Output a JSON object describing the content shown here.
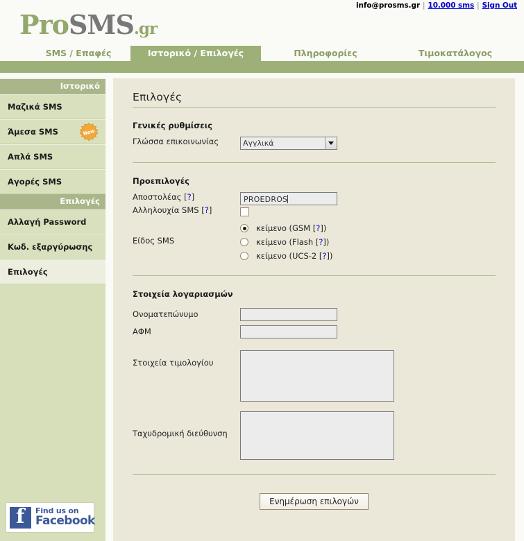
{
  "topbar": {
    "email": "info@prosms.gr",
    "separator": "|",
    "credits": "10.000 sms",
    "signout": "Sign Out"
  },
  "logo": {
    "part1": "Pro",
    "part2": "SMS",
    "part3": ".gr"
  },
  "nav": {
    "tabs": [
      {
        "label": "SMS / Επαφές",
        "active": false
      },
      {
        "label": "Ιστορικό / Επιλογές",
        "active": true
      },
      {
        "label": "Πληροφορίες",
        "active": false
      },
      {
        "label": "Τιμοκατάλογος",
        "active": false
      }
    ]
  },
  "sidebar": {
    "group1_title": "Ιστορικό",
    "group1_items": [
      {
        "label": "Μαζικά SMS",
        "badge": ""
      },
      {
        "label": "Άμεσα SMS",
        "badge": "New"
      },
      {
        "label": "Απλά SMS",
        "badge": ""
      },
      {
        "label": "Αγορές SMS",
        "badge": ""
      }
    ],
    "group2_title": "Επιλογές",
    "group2_items": [
      {
        "label": "Αλλαγή Password",
        "selected": false
      },
      {
        "label": "Κωδ. εξαργύρωσης",
        "selected": false
      },
      {
        "label": "Επιλογές",
        "selected": true
      }
    ],
    "facebook": {
      "line1": "Find us on",
      "line2": "Facebook",
      "icon": "facebook-f-icon"
    }
  },
  "main": {
    "page_title": "Επιλογές",
    "section_general": "Γενικές ρυθμίσεις",
    "language_label": "Γλώσσα επικοινωνίας",
    "language_value": "Αγγλικά",
    "language_options": [
      "Αγγλικά"
    ],
    "section_defaults": "Προεπιλογές",
    "sender_label": "Αποστολέας",
    "sender_help": "?",
    "sender_value": "PROEDROS",
    "concat_label": "Αλληλουχία SMS",
    "concat_help": "?",
    "concat_checked": false,
    "smstype_label": "Είδος SMS",
    "smstype_options": [
      {
        "label": "κείμενο (GSM [",
        "help": "?",
        "tail": "])",
        "checked": true
      },
      {
        "label": "κείμενο (Flash [",
        "help": "?",
        "tail": "])",
        "checked": false
      },
      {
        "label": "κείμενο (UCS-2 [",
        "help": "?",
        "tail": "])",
        "checked": false
      }
    ],
    "section_account": "Στοιχεία λογαριασμών",
    "fullname_label": "Ονοματεπώνυμο",
    "fullname_value": "",
    "vat_label": "ΑΦΜ",
    "vat_value": "",
    "invoice_label": "Στοιχεία τιμολογίου",
    "invoice_value": "",
    "address_label": "Ταχυδρομική διεύθυνση",
    "address_value": "",
    "submit_label": "Ενημέρωση επιλογών"
  },
  "colors": {
    "olive": "#9DB077",
    "olive_dark": "#A8B689",
    "sidebar_bg": "#D7DFBA",
    "content_bg": "#EBE8DA",
    "link": "#0000CC"
  }
}
